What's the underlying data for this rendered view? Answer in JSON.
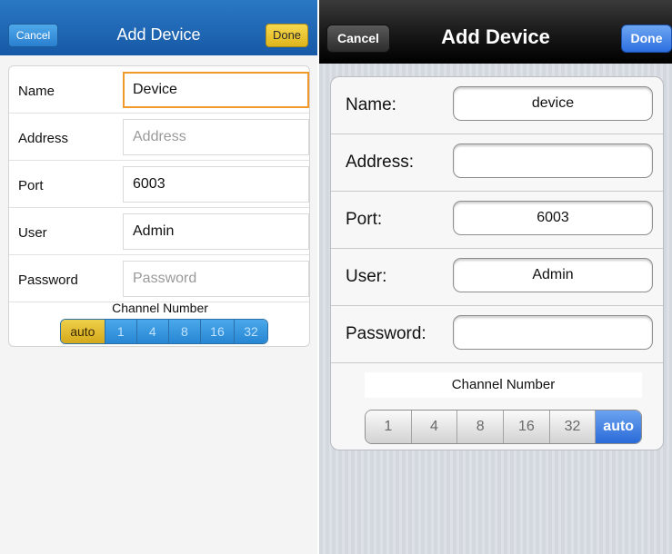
{
  "left": {
    "nav": {
      "cancel_label": "Cancel",
      "title": "Add Device",
      "done_label": "Done"
    },
    "fields": [
      {
        "label": "Name",
        "value": "Device",
        "placeholder": ""
      },
      {
        "label": "Address",
        "value": "",
        "placeholder": "Address"
      },
      {
        "label": "Port",
        "value": "6003",
        "placeholder": ""
      },
      {
        "label": "User",
        "value": "Admin",
        "placeholder": ""
      },
      {
        "label": "Password",
        "value": "",
        "placeholder": "Password"
      }
    ],
    "channel": {
      "label": "Channel Number",
      "options": [
        "auto",
        "1",
        "4",
        "8",
        "16",
        "32"
      ],
      "selected": "auto"
    },
    "colors": {
      "nav_bg": "#1f66b3",
      "done_bg": "#ecc83a",
      "focus_border": "#f19a2b",
      "segment_bg": "#3595de",
      "segment_selected": "#e5bf36"
    }
  },
  "right": {
    "nav": {
      "cancel_label": "Cancel",
      "title": "Add Device",
      "done_label": "Done"
    },
    "fields": [
      {
        "label": "Name:",
        "value": "device"
      },
      {
        "label": "Address:",
        "value": ""
      },
      {
        "label": "Port:",
        "value": "6003"
      },
      {
        "label": "User:",
        "value": "Admin"
      },
      {
        "label": "Password:",
        "value": ""
      }
    ],
    "channel": {
      "label": "Channel Number",
      "options": [
        "1",
        "4",
        "8",
        "16",
        "32",
        "auto"
      ],
      "selected": "auto"
    },
    "colors": {
      "nav_bg": "#111111",
      "done_bg": "#3a7ae6",
      "segment_selected": "#3a7ae6"
    }
  }
}
